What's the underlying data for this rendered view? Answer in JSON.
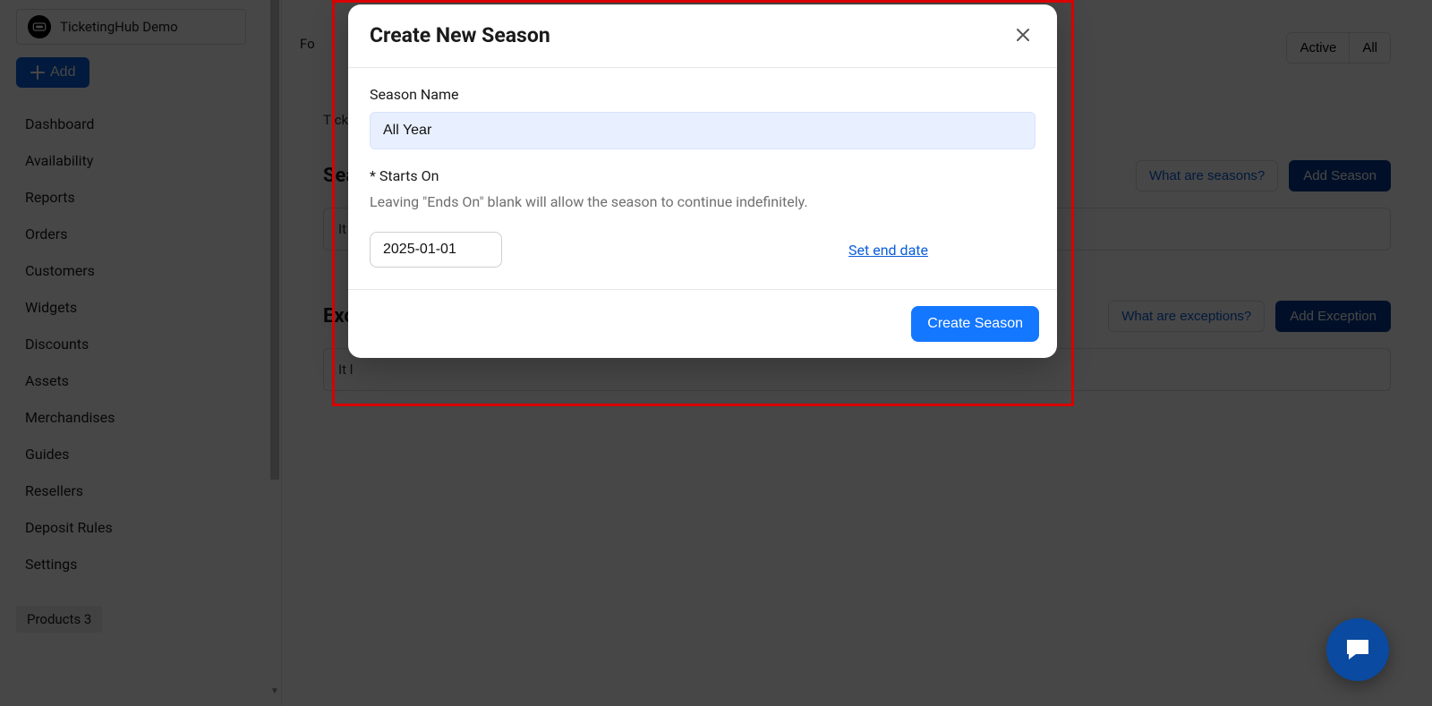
{
  "sidebar": {
    "org_name": "TicketingHub Demo",
    "add_label": "Add",
    "items": [
      {
        "label": "Dashboard"
      },
      {
        "label": "Availability"
      },
      {
        "label": "Reports"
      },
      {
        "label": "Orders"
      },
      {
        "label": "Customers"
      },
      {
        "label": "Widgets"
      },
      {
        "label": "Discounts"
      },
      {
        "label": "Assets"
      },
      {
        "label": "Merchandises"
      },
      {
        "label": "Guides"
      },
      {
        "label": "Resellers"
      },
      {
        "label": "Deposit Rules"
      },
      {
        "label": "Settings"
      }
    ],
    "products_chip": "Products 3"
  },
  "main": {
    "toggle": {
      "active": "Active",
      "all": "All"
    },
    "breadcrumb": "Tick",
    "top_text": "Fo",
    "seasons": {
      "title": "Sea",
      "help_link": "What are seasons?",
      "add_btn": "Add Season",
      "empty": "It l"
    },
    "exceptions": {
      "title": "Exc",
      "help_link": "What are exceptions?",
      "add_btn": "Add Exception",
      "empty": "It l"
    }
  },
  "modal": {
    "title": "Create New Season",
    "name_label": "Season Name",
    "name_value": "All Year",
    "starts_label": "* Starts On",
    "helper": "Leaving \"Ends On\" blank will allow the season to continue indefinitely.",
    "start_date": "2025-01-01",
    "end_link": "Set end date",
    "submit": "Create Season"
  }
}
